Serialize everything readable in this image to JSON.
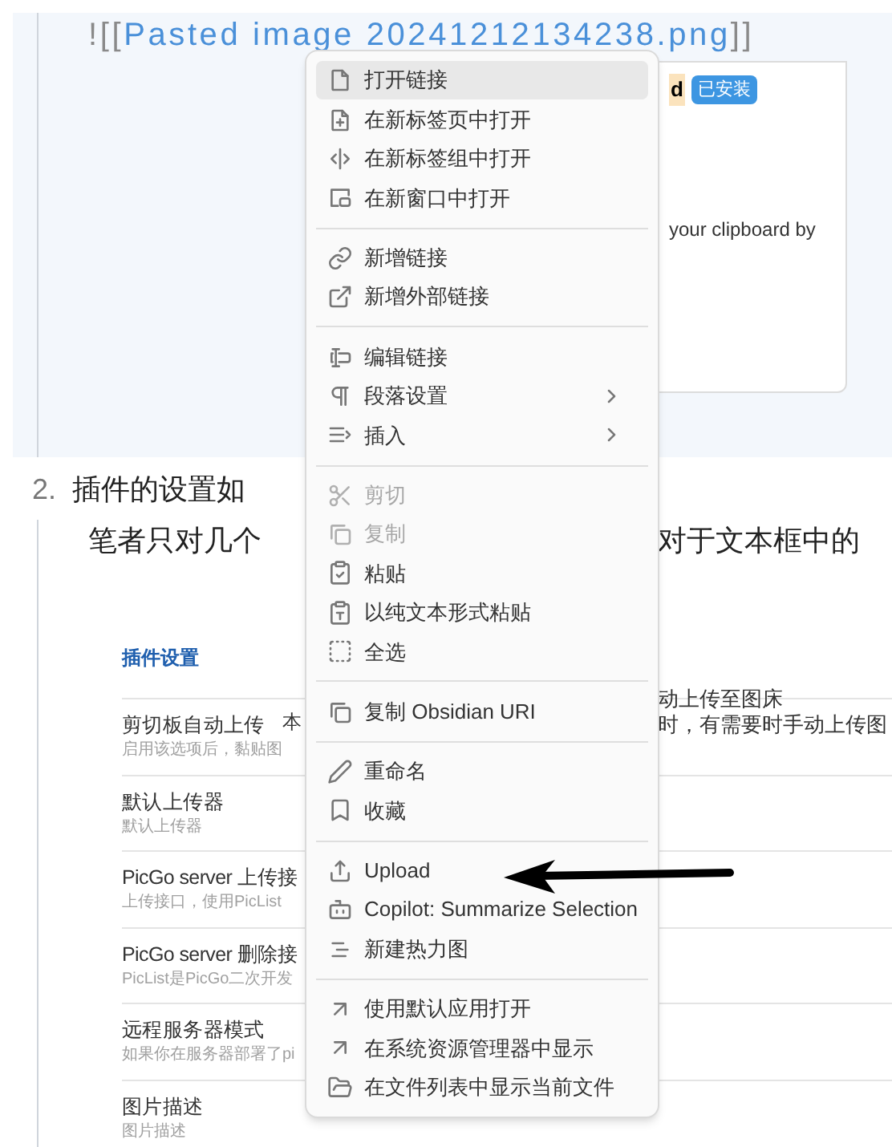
{
  "editor": {
    "embed": {
      "prefix": "![[",
      "link": "Pasted image 20241212134238.png",
      "suffix": "]]"
    },
    "embedded_card": {
      "title_fragment": "d",
      "badge": "已安装",
      "text_fragment": "your clipboard by"
    },
    "list_item": {
      "number": "2.",
      "text": "插件的设置如"
    },
    "paragraph": {
      "left": "笔者只对几个",
      "right": "对于文本框中的"
    },
    "settings_screenshot": {
      "heading": "插件设置",
      "overlay_lines": [
        {
          "right": "动上传至图床"
        },
        {
          "left": "本",
          "right": "时，有需要时手动上传图"
        }
      ],
      "rows": [
        {
          "title": "剪切板自动上传",
          "description": "启用该选项后，黏贴图"
        },
        {
          "title": "默认上传器",
          "description": "默认上传器"
        },
        {
          "title": "PicGo server 上传接",
          "description": "上传接口，使用PicList"
        },
        {
          "title": "PicGo server 删除接",
          "description": "PicList是PicGo二次开发"
        },
        {
          "title": "远程服务器模式",
          "description": "如果你在服务器部署了pi"
        },
        {
          "title": "图片描述",
          "description": "图片描述"
        }
      ]
    }
  },
  "context_menu": {
    "groups": [
      [
        {
          "label": "打开链接",
          "selected": true,
          "disabled": false,
          "submenu": false
        },
        {
          "label": "在新标签页中打开",
          "selected": false,
          "disabled": false,
          "submenu": false
        },
        {
          "label": "在新标签组中打开",
          "selected": false,
          "disabled": false,
          "submenu": false
        },
        {
          "label": "在新窗口中打开",
          "selected": false,
          "disabled": false,
          "submenu": false
        }
      ],
      [
        {
          "label": "新增链接",
          "selected": false,
          "disabled": false,
          "submenu": false
        },
        {
          "label": "新增外部链接",
          "selected": false,
          "disabled": false,
          "submenu": false
        }
      ],
      [
        {
          "label": "编辑链接",
          "selected": false,
          "disabled": false,
          "submenu": false
        },
        {
          "label": "段落设置",
          "selected": false,
          "disabled": false,
          "submenu": true
        },
        {
          "label": "插入",
          "selected": false,
          "disabled": false,
          "submenu": true
        }
      ],
      [
        {
          "label": "剪切",
          "selected": false,
          "disabled": true,
          "submenu": false
        },
        {
          "label": "复制",
          "selected": false,
          "disabled": true,
          "submenu": false
        },
        {
          "label": "粘贴",
          "selected": false,
          "disabled": false,
          "submenu": false
        },
        {
          "label": "以纯文本形式粘贴",
          "selected": false,
          "disabled": false,
          "submenu": false
        },
        {
          "label": "全选",
          "selected": false,
          "disabled": false,
          "submenu": false
        }
      ],
      [
        {
          "label": "复制 Obsidian URI",
          "selected": false,
          "disabled": false,
          "submenu": false
        }
      ],
      [
        {
          "label": "重命名",
          "selected": false,
          "disabled": false,
          "submenu": false
        },
        {
          "label": "收藏",
          "selected": false,
          "disabled": false,
          "submenu": false
        }
      ],
      [
        {
          "label": "Upload",
          "selected": false,
          "disabled": false,
          "submenu": false
        },
        {
          "label": "Copilot: Summarize Selection",
          "selected": false,
          "disabled": false,
          "submenu": false
        },
        {
          "label": "新建热力图",
          "selected": false,
          "disabled": false,
          "submenu": false
        }
      ],
      [
        {
          "label": "使用默认应用打开",
          "selected": false,
          "disabled": false,
          "submenu": false
        },
        {
          "label": "在系统资源管理器中显示",
          "selected": false,
          "disabled": false,
          "submenu": false
        },
        {
          "label": "在文件列表中显示当前文件",
          "selected": false,
          "disabled": false,
          "submenu": false
        }
      ]
    ]
  }
}
